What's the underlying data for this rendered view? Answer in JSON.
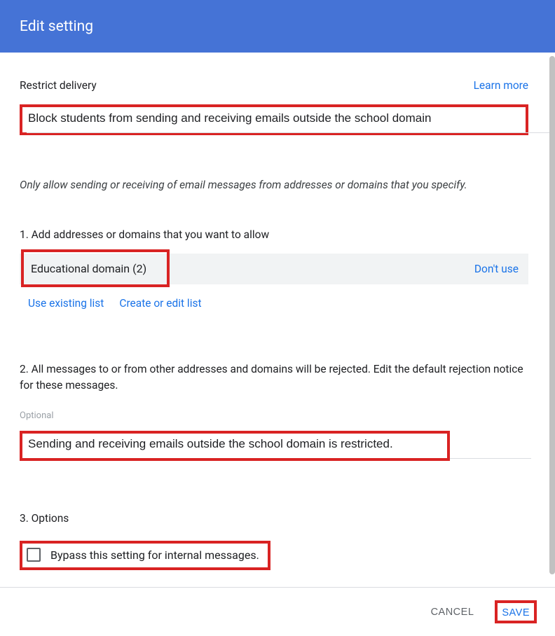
{
  "header": {
    "title": "Edit setting"
  },
  "section": {
    "label": "Restrict delivery",
    "learn_more": "Learn more"
  },
  "description": {
    "value": "Block students from sending and receiving emails outside the school domain"
  },
  "info": "Only allow sending or receiving of email messages from addresses or domains that you specify.",
  "step1": {
    "label": "1. Add addresses or domains that you want to allow",
    "domain_name": "Educational domain (2)",
    "dont_use": "Don't use",
    "use_existing": "Use existing list",
    "create_edit": "Create or edit list"
  },
  "step2": {
    "label": "2. All messages to or from other addresses and domains will be rejected. Edit the default rejection notice for these messages.",
    "optional": "Optional",
    "rejection_value": "Sending and receiving emails outside the school domain is restricted."
  },
  "step3": {
    "label": "3. Options",
    "checkbox_label": "Bypass this setting for internal messages."
  },
  "footer": {
    "cancel": "CANCEL",
    "save": "SAVE"
  }
}
